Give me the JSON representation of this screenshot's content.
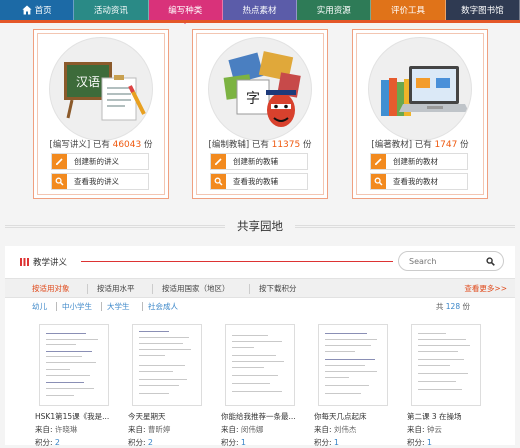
{
  "nav": [
    {
      "label": "首页",
      "icon": "home-icon",
      "color": "#1c6aa6"
    },
    {
      "label": "活动资讯",
      "color": "#2a8a86"
    },
    {
      "label": "编写种类",
      "color": "#d9327a",
      "active": true
    },
    {
      "label": "热点素材",
      "color": "#5b5ca9"
    },
    {
      "label": "实用资源",
      "color": "#2e7b57"
    },
    {
      "label": "评价工具",
      "color": "#e07319"
    },
    {
      "label": "数字图书馆",
      "color": "#2f3a52"
    }
  ],
  "accent_color": "#e45728",
  "cards": [
    {
      "prefix": "[编写讲义] 已有",
      "count": "46043",
      "unit": "份",
      "create_label": "创建新的讲义",
      "view_label": "查看我的讲义"
    },
    {
      "prefix": "[编制教辅] 已有",
      "count": "11375",
      "unit": "份",
      "create_label": "创建新的教辅",
      "view_label": "查看我的教辅"
    },
    {
      "prefix": "[编著教材] 已有",
      "count": "1747",
      "unit": "份",
      "create_label": "创建新的教材",
      "view_label": "查看我的教材"
    }
  ],
  "illustration_text": {
    "chalkboard": "汉语",
    "character": "字"
  },
  "shared_title": "共享园地",
  "section": {
    "title": "教学讲义",
    "search_placeholder": "Search",
    "more": "查看更多>>"
  },
  "filters": [
    "按适用对象",
    "按适用水平",
    "按适用国家（地区）",
    "按下载积分"
  ],
  "categories": [
    "幼儿",
    "中小学生",
    "大学生",
    "社会成人"
  ],
  "total": {
    "prefix": "共",
    "count": "128",
    "unit": "份"
  },
  "labels": {
    "from": "来自:",
    "score": "积分:"
  },
  "documents": [
    {
      "title": "HSK1第15课《我是...",
      "author": "许晓琳",
      "score": "2"
    },
    {
      "title": "今天星期天",
      "author": "曹昕婷",
      "score": "2"
    },
    {
      "title": "你能给我推荐一条最...",
      "author": "闵伟娜",
      "score": "1"
    },
    {
      "title": "你每天几点起床",
      "author": "刘伟杰",
      "score": "1"
    },
    {
      "title": "第二课 3 在操场",
      "author": "钟云",
      "score": "1"
    }
  ]
}
